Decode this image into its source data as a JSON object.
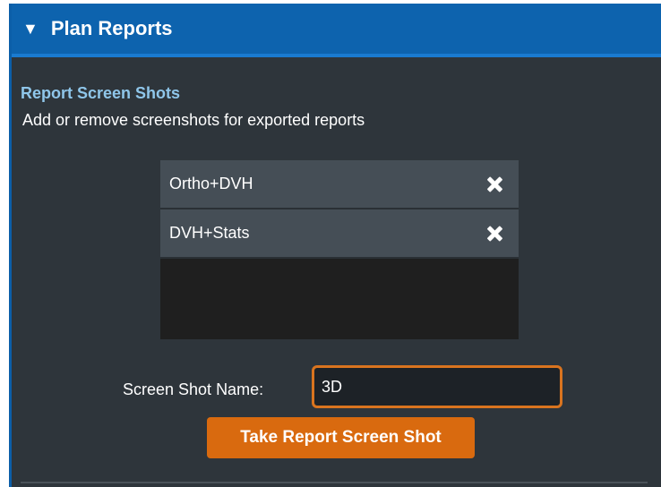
{
  "panel": {
    "title": "Plan Reports",
    "collapse_icon": "▼",
    "header_color": "#0d63ae"
  },
  "section": {
    "title": "Report Screen Shots",
    "description": "Add or remove screenshots for exported reports"
  },
  "screenshots": {
    "items": [
      {
        "label": "Ortho+DVH",
        "remove_icon": "close-icon"
      },
      {
        "label": "DVH+Stats",
        "remove_icon": "close-icon"
      }
    ]
  },
  "form": {
    "name_label": "Screen Shot Name:",
    "name_value": "3D",
    "take_button_label": "Take Report Screen Shot",
    "accent_color": "#d96a0f"
  }
}
